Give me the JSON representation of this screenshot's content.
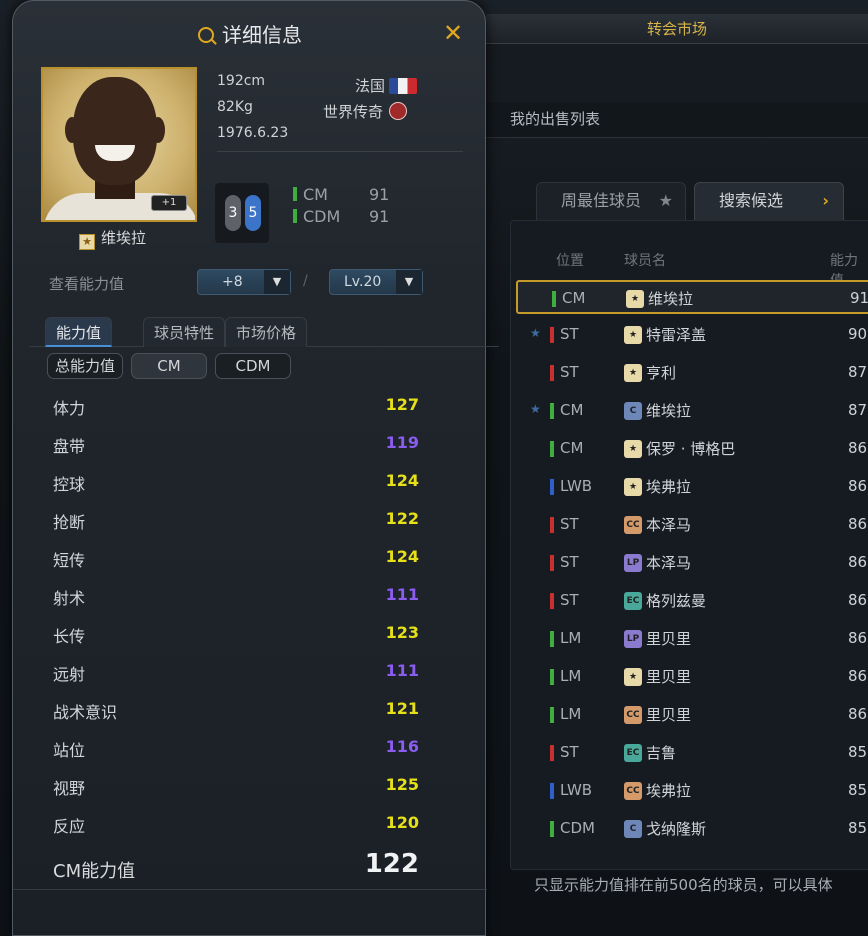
{
  "market": {
    "title": "转会市场",
    "sell_list": "我的出售列表",
    "tab_weekly": "周最佳球员",
    "tab_search": "搜索候选",
    "col_position": "位置",
    "col_name": "球员名",
    "col_rating": "能力值",
    "footer": "只显示能力值排在前500名的球员，可以具体",
    "rows": [
      {
        "pos": "CM",
        "name": "维埃拉",
        "ovr": "91",
        "badge": "★",
        "fav": false
      },
      {
        "pos": "ST",
        "name": "特雷泽盖",
        "ovr": "90",
        "badge": "★",
        "fav": true
      },
      {
        "pos": "ST",
        "name": "亨利",
        "ovr": "87",
        "badge": "★",
        "fav": false
      },
      {
        "pos": "CM",
        "name": "维埃拉",
        "ovr": "87",
        "badge": "C",
        "fav": true
      },
      {
        "pos": "CM",
        "name": "保罗 · 博格巴",
        "ovr": "86",
        "badge": "★",
        "fav": false
      },
      {
        "pos": "LWB",
        "name": "埃弗拉",
        "ovr": "86",
        "badge": "★",
        "fav": false
      },
      {
        "pos": "ST",
        "name": "本泽马",
        "ovr": "86",
        "badge": "CC",
        "fav": false
      },
      {
        "pos": "ST",
        "name": "本泽马",
        "ovr": "86",
        "badge": "LP",
        "fav": false
      },
      {
        "pos": "ST",
        "name": "格列兹曼",
        "ovr": "86",
        "badge": "EC",
        "fav": false
      },
      {
        "pos": "LM",
        "name": "里贝里",
        "ovr": "86",
        "badge": "LP",
        "fav": false
      },
      {
        "pos": "LM",
        "name": "里贝里",
        "ovr": "86",
        "badge": "★",
        "fav": false
      },
      {
        "pos": "LM",
        "name": "里贝里",
        "ovr": "86",
        "badge": "CC",
        "fav": false
      },
      {
        "pos": "ST",
        "name": "吉鲁",
        "ovr": "85",
        "badge": "EC",
        "fav": false
      },
      {
        "pos": "LWB",
        "name": "埃弗拉",
        "ovr": "85",
        "badge": "CC",
        "fav": false
      },
      {
        "pos": "CDM",
        "name": "戈纳隆斯",
        "ovr": "85",
        "badge": "C",
        "fav": false
      }
    ]
  },
  "detail": {
    "title": "详细信息",
    "player_name": "维埃拉",
    "photo_tag": "+1",
    "height": "192cm",
    "weight": "82Kg",
    "birth": "1976.6.23",
    "nation": "法国",
    "season": "世界传奇",
    "foot_left": "3",
    "foot_right": "5",
    "positions": [
      {
        "pos": "CM",
        "val": "91"
      },
      {
        "pos": "CDM",
        "val": "91"
      }
    ],
    "view_label": "查看能力值",
    "upgrade": "+8",
    "level": "Lv.20",
    "slash": "/",
    "tabs": [
      "能力值",
      "球员特性",
      "市场价格"
    ],
    "pills": [
      "总能力值",
      "CM",
      "CDM"
    ],
    "stats": [
      {
        "name": "体力",
        "value": "127",
        "tone": "yellow"
      },
      {
        "name": "盘带",
        "value": "119",
        "tone": "purple"
      },
      {
        "name": "控球",
        "value": "124",
        "tone": "yellow"
      },
      {
        "name": "抢断",
        "value": "122",
        "tone": "yellow"
      },
      {
        "name": "短传",
        "value": "124",
        "tone": "yellow"
      },
      {
        "name": "射术",
        "value": "111",
        "tone": "purple"
      },
      {
        "name": "长传",
        "value": "123",
        "tone": "yellow"
      },
      {
        "name": "远射",
        "value": "111",
        "tone": "purple"
      },
      {
        "name": "战术意识",
        "value": "121",
        "tone": "yellow"
      },
      {
        "name": "站位",
        "value": "116",
        "tone": "purple"
      },
      {
        "name": "视野",
        "value": "125",
        "tone": "yellow"
      },
      {
        "name": "反应",
        "value": "120",
        "tone": "yellow"
      }
    ],
    "total_label": "CM能力值",
    "total_value": "122"
  },
  "colors": {
    "accent": "#e0a820",
    "yellow": "#e6e01a",
    "purple": "#8a5cf0",
    "cm_bar": "#3fae3f",
    "st_bar": "#c83030",
    "lwb_bar": "#2f5fc8"
  }
}
